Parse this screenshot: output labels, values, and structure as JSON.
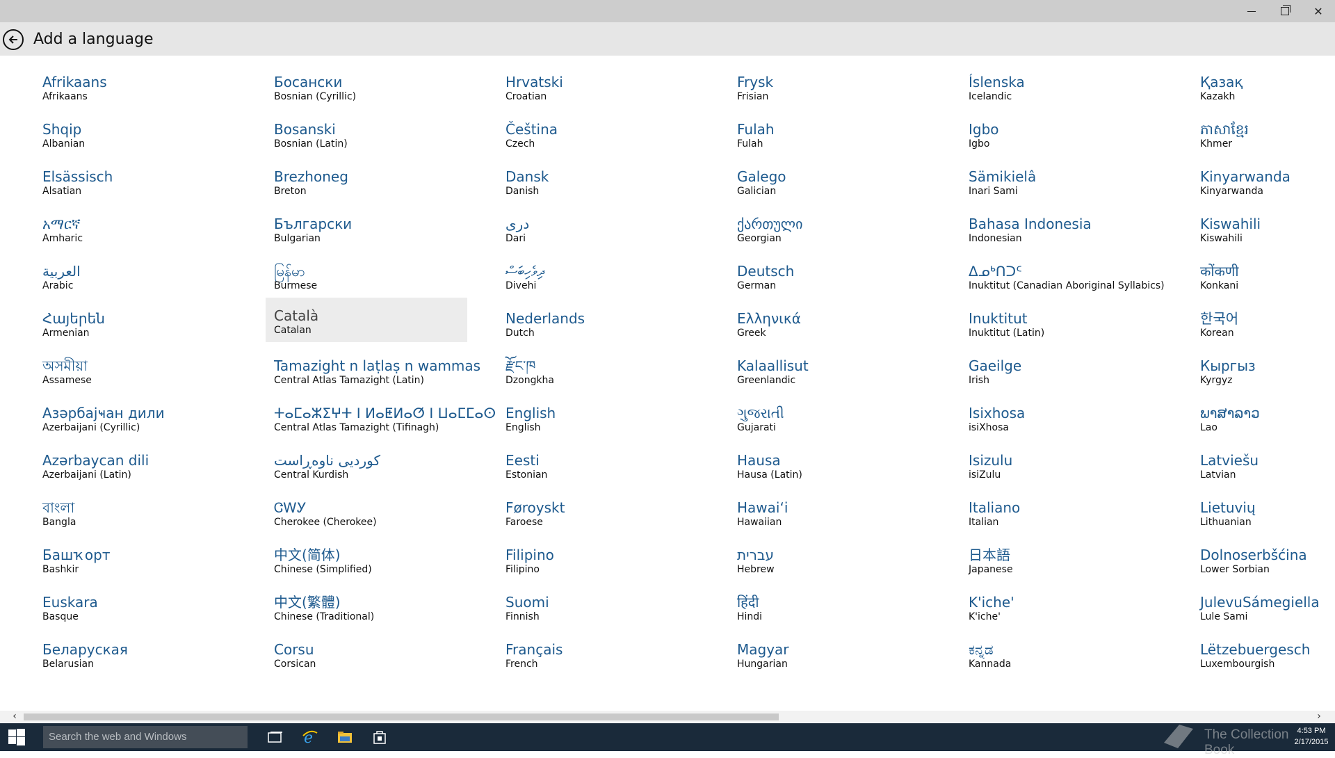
{
  "window": {
    "minimize_icon": "minimize-icon",
    "maximize_icon": "restore-icon",
    "close_icon": "close-icon"
  },
  "header": {
    "back_icon": "back-arrow-icon",
    "title": "Add a language"
  },
  "languages": [
    [
      {
        "native": "Afrikaans",
        "english": "Afrikaans"
      },
      {
        "native": "Shqip",
        "english": "Albanian"
      },
      {
        "native": "Elsässisch",
        "english": "Alsatian"
      },
      {
        "native": "አማርኛ",
        "english": "Amharic"
      },
      {
        "native": "العربية",
        "english": "Arabic"
      },
      {
        "native": "Հայերեն",
        "english": "Armenian"
      },
      {
        "native": "অসমীয়া",
        "english": "Assamese"
      },
      {
        "native": "Азәрбајҹан дили",
        "english": "Azerbaijani (Cyrillic)"
      },
      {
        "native": "Azərbaycan dili",
        "english": "Azerbaijani (Latin)"
      },
      {
        "native": "বাংলা",
        "english": "Bangla"
      },
      {
        "native": "Башҡорт",
        "english": "Bashkir"
      },
      {
        "native": "Euskara",
        "english": "Basque"
      },
      {
        "native": "Беларуская",
        "english": "Belarusian"
      }
    ],
    [
      {
        "native": "Босански",
        "english": "Bosnian (Cyrillic)"
      },
      {
        "native": "Bosanski",
        "english": "Bosnian (Latin)"
      },
      {
        "native": "Brezhoneg",
        "english": "Breton"
      },
      {
        "native": "Български",
        "english": "Bulgarian"
      },
      {
        "native": "မြန်မာ",
        "english": "Burmese"
      },
      {
        "native": "Català",
        "english": "Catalan"
      },
      {
        "native": "Tamazight n laṭlaṣ n wammas",
        "english": "Central Atlas Tamazight (Latin)"
      },
      {
        "native": "ⵜⴰⵎⴰⵣⵉⵖⵜ ⵏ ⵍⴰⵟⵍⴰⵚ ⵏ ⵡⴰⵎⵎⴰⵙ",
        "english": "Central Atlas Tamazight (Tifinagh)"
      },
      {
        "native": "کوردیی ناوەڕاست",
        "english": "Central Kurdish"
      },
      {
        "native": "ᏣᎳᎩ",
        "english": "Cherokee (Cherokee)"
      },
      {
        "native": "中文(简体)",
        "english": "Chinese (Simplified)"
      },
      {
        "native": "中文(繁體)",
        "english": "Chinese (Traditional)"
      },
      {
        "native": "Corsu",
        "english": "Corsican"
      }
    ],
    [
      {
        "native": "Hrvatski",
        "english": "Croatian"
      },
      {
        "native": "Čeština",
        "english": "Czech"
      },
      {
        "native": "Dansk",
        "english": "Danish"
      },
      {
        "native": "دری",
        "english": "Dari"
      },
      {
        "native": "ދިވެހިބަސް",
        "english": "Divehi"
      },
      {
        "native": "Nederlands",
        "english": "Dutch"
      },
      {
        "native": "རྫོང་ཁ",
        "english": "Dzongkha"
      },
      {
        "native": "English",
        "english": "English"
      },
      {
        "native": "Eesti",
        "english": "Estonian"
      },
      {
        "native": "Føroyskt",
        "english": "Faroese"
      },
      {
        "native": "Filipino",
        "english": "Filipino"
      },
      {
        "native": "Suomi",
        "english": "Finnish"
      },
      {
        "native": "Français",
        "english": "French"
      }
    ],
    [
      {
        "native": "Frysk",
        "english": "Frisian"
      },
      {
        "native": "Fulah",
        "english": "Fulah"
      },
      {
        "native": "Galego",
        "english": "Galician"
      },
      {
        "native": "ქართული",
        "english": "Georgian"
      },
      {
        "native": "Deutsch",
        "english": "German"
      },
      {
        "native": "Ελληνικά",
        "english": "Greek"
      },
      {
        "native": "Kalaallisut",
        "english": "Greenlandic"
      },
      {
        "native": "ગુજરાતી",
        "english": "Gujarati"
      },
      {
        "native": "Hausa",
        "english": "Hausa (Latin)"
      },
      {
        "native": "Hawaiʻi",
        "english": "Hawaiian"
      },
      {
        "native": "עברית",
        "english": "Hebrew"
      },
      {
        "native": "हिंदी",
        "english": "Hindi"
      },
      {
        "native": "Magyar",
        "english": "Hungarian"
      }
    ],
    [
      {
        "native": "Íslenska",
        "english": "Icelandic"
      },
      {
        "native": "Igbo",
        "english": "Igbo"
      },
      {
        "native": "Sämikielâ",
        "english": "Inari Sami"
      },
      {
        "native": "Bahasa Indonesia",
        "english": "Indonesian"
      },
      {
        "native": "ᐃᓄᒃᑎᑐᑦ",
        "english": "Inuktitut (Canadian Aboriginal Syllabics)"
      },
      {
        "native": "Inuktitut",
        "english": "Inuktitut (Latin)"
      },
      {
        "native": "Gaeilge",
        "english": "Irish"
      },
      {
        "native": "Isixhosa",
        "english": "isiXhosa"
      },
      {
        "native": "Isizulu",
        "english": "isiZulu"
      },
      {
        "native": "Italiano",
        "english": "Italian"
      },
      {
        "native": "日本語",
        "english": "Japanese"
      },
      {
        "native": "K'iche'",
        "english": "K'iche'"
      },
      {
        "native": "ಕನ್ನಡ",
        "english": "Kannada"
      }
    ],
    [
      {
        "native": "Қазақ",
        "english": "Kazakh"
      },
      {
        "native": "ភាសាខ្មែរ",
        "english": "Khmer"
      },
      {
        "native": "Kinyarwanda",
        "english": "Kinyarwanda"
      },
      {
        "native": "Kiswahili",
        "english": "Kiswahili"
      },
      {
        "native": "कोंकणी",
        "english": "Konkani"
      },
      {
        "native": "한국어",
        "english": "Korean"
      },
      {
        "native": "Кыргыз",
        "english": "Kyrgyz"
      },
      {
        "native": "ພາສາລາວ",
        "english": "Lao"
      },
      {
        "native": "Latviešu",
        "english": "Latvian"
      },
      {
        "native": "Lietuvių",
        "english": "Lithuanian"
      },
      {
        "native": "Dolnoserbšćina",
        "english": "Lower Sorbian"
      },
      {
        "native": "JulevuSámegiella",
        "english": "Lule Sami"
      },
      {
        "native": "Lëtzebuergesch",
        "english": "Luxembourgish"
      }
    ]
  ],
  "selected": {
    "column": 1,
    "row": 5
  },
  "scrollbar": {
    "left_arrow": "‹",
    "right_arrow": "›",
    "position_fraction": 0.0
  },
  "taskbar": {
    "start_icon": "windows-start-icon",
    "search_placeholder": "Search the web and Windows",
    "task_view_icon": "task-view-icon",
    "ie_icon": "internet-explorer-icon",
    "explorer_icon": "file-explorer-icon",
    "store_icon": "store-icon"
  },
  "watermark": "The Collection Book",
  "clock": {
    "time": "4:53 PM",
    "date": "2/17/2015"
  }
}
